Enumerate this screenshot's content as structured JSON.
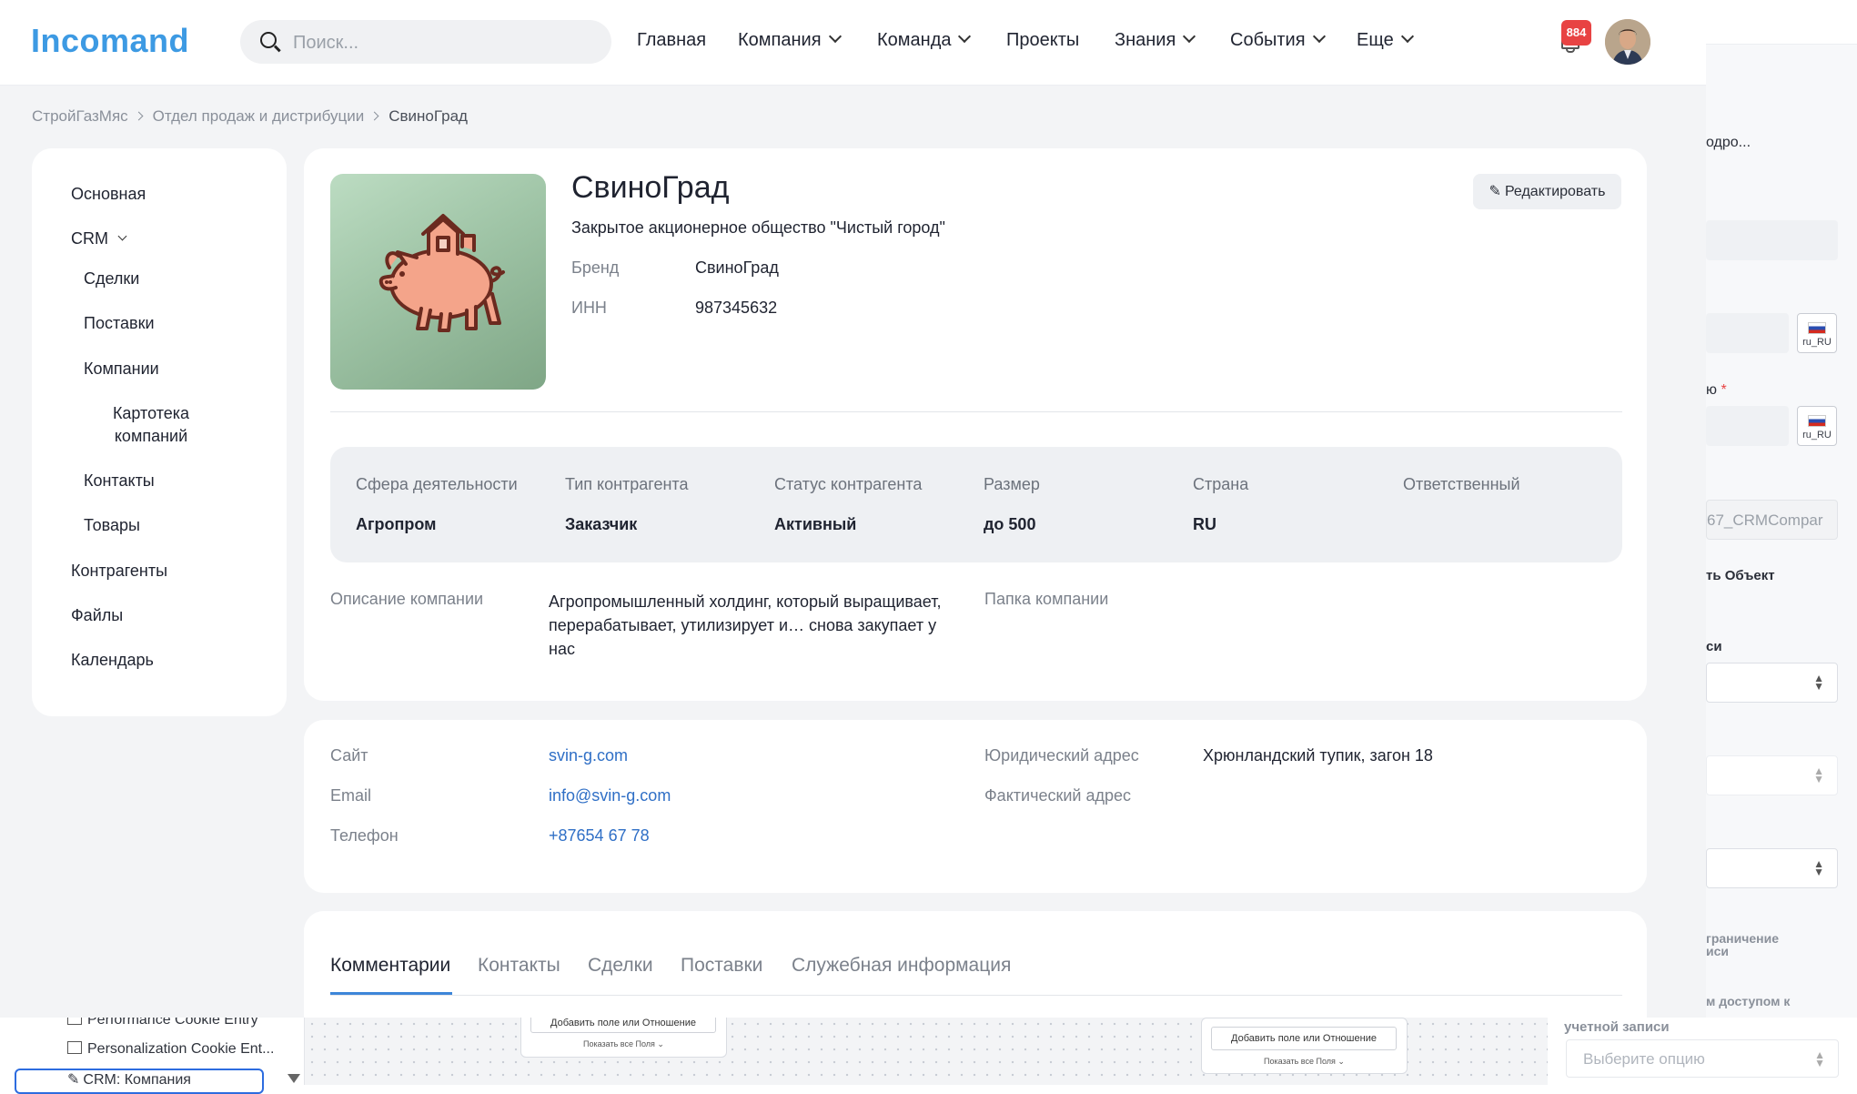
{
  "header": {
    "logo": "Incomand",
    "search_placeholder": "Поиск...",
    "nav": [
      "Главная",
      "Компания",
      "Команда",
      "Проекты",
      "Знания",
      "События",
      "Еще"
    ],
    "notifications_count": "884"
  },
  "breadcrumb": [
    "СтройГазМяс",
    "Отдел продаж и дистрибуции",
    "СвиноГрад"
  ],
  "sidebar": {
    "items": [
      "Основная",
      "CRM",
      "Сделки",
      "Поставки",
      "Компании",
      "Картотека компаний",
      "Контакты",
      "Товары",
      "Контрагенты",
      "Файлы",
      "Календарь"
    ]
  },
  "company": {
    "name": "СвиноГрад",
    "legal_name": "Закрытое акционерное общество \"Чистый город\"",
    "edit_label": "Редактировать",
    "brand_label": "Бренд",
    "brand": "СвиноГрад",
    "inn_label": "ИНН",
    "inn": "987345632"
  },
  "attributes": [
    {
      "label": "Сфера деятельности",
      "value": "Агропром"
    },
    {
      "label": "Тип контрагента",
      "value": "Заказчик"
    },
    {
      "label": "Статус контрагента",
      "value": "Активный"
    },
    {
      "label": "Размер",
      "value": "до 500"
    },
    {
      "label": "Страна",
      "value": "RU"
    },
    {
      "label": "Ответственный",
      "value": ""
    }
  ],
  "description": {
    "label": "Описание компании",
    "text": "Агропромышленный холдинг, который выращивает, перерабатывает, утилизирует и… снова закупает у нас",
    "folder_label": "Папка компании"
  },
  "contacts": {
    "site_label": "Сайт",
    "site": "svin-g.com",
    "email_label": "Email",
    "email": "info@svin-g.com",
    "phone_label": "Телефон",
    "phone": "+87654 67 78",
    "legal_address_label": "Юридический адрес",
    "legal_address": "Хрюнландский тупик, загон 18",
    "actual_address_label": "Фактический адрес"
  },
  "tabs": [
    "Комментарии",
    "Контакты",
    "Сделки",
    "Поставки",
    "Служебная информация"
  ],
  "background": {
    "fragments": [
      "одро...",
      "ю",
      "67_CRMCompar",
      "ть Объект",
      "си",
      "граничение",
      "иси",
      "м доступом к",
      "учетной записи"
    ],
    "locale": "ru_RU",
    "select_placeholder": "Выберите опцию",
    "tree": [
      "Performance Cookie Entry",
      "Personalization Cookie Ent...",
      "CRM: Компания"
    ],
    "canvas_btn": "Добавить поле или Отношение",
    "canvas_sub": "Показать все Поля"
  },
  "colors": {
    "accent": "#3d9ae3",
    "link": "#2f6fc6",
    "badge": "#e84343"
  }
}
